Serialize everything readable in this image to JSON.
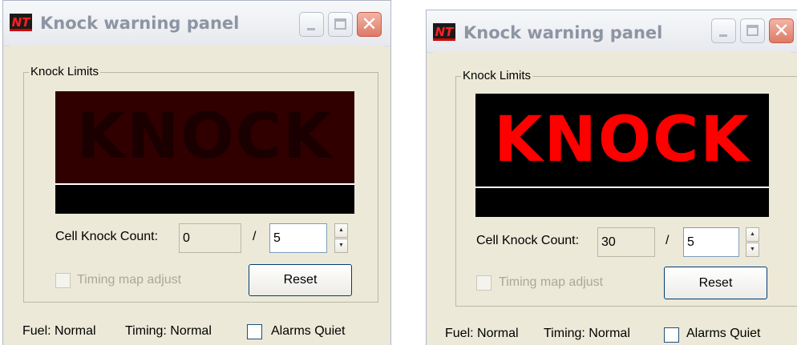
{
  "window_title": "Knock warning panel",
  "app_icon_text": "NT",
  "titlebar": {
    "minimize": "_",
    "maximize": "□",
    "close": "✕"
  },
  "group_label": "Knock Limits",
  "knock_text": "KNOCK",
  "cell_knock_count_label": "Cell Knock Count:",
  "separator": "/",
  "limit_value": "5",
  "timing_map_adjust_label": "Timing map adjust",
  "reset_label": "Reset",
  "fuel_status": "Fuel: Normal",
  "timing_status": "Timing: Normal",
  "alarms_quiet_label": "Alarms Quiet",
  "panels": [
    {
      "state": "inactive",
      "knock_color": "#1a0000",
      "count_value": "0"
    },
    {
      "state": "active",
      "knock_color": "#ff0000",
      "count_value": "30"
    }
  ],
  "colors": {
    "dark_red_bg": "#300000",
    "active_bg": "#000000",
    "alert_red": "#ff0000"
  }
}
